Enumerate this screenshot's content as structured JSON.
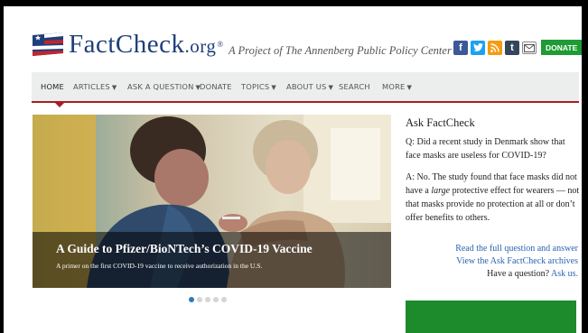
{
  "header": {
    "logo_text_main": "FactCheck",
    "logo_text_suffix": ".org",
    "logo_reg": "®",
    "tagline": "A Project of The Annenberg Public Policy Center",
    "social_icons": [
      "facebook-icon",
      "twitter-icon",
      "rss-icon",
      "tumblr-icon",
      "email-icon"
    ],
    "donate_label": "DONATE"
  },
  "nav": {
    "items": [
      {
        "label": "HOME",
        "has_dropdown": false
      },
      {
        "label": "ARTICLES",
        "has_dropdown": true
      },
      {
        "label": "ASK A QUESTION",
        "has_dropdown": true
      },
      {
        "label": "DONATE",
        "has_dropdown": false
      },
      {
        "label": "TOPICS",
        "has_dropdown": true
      },
      {
        "label": "ABOUT US",
        "has_dropdown": true
      },
      {
        "label": "SEARCH",
        "has_dropdown": false
      },
      {
        "label": "MORE",
        "has_dropdown": true
      }
    ],
    "accent_color": "#a61f24"
  },
  "hero": {
    "title": "A Guide to Pfizer/BioNTech’s COVID-19 Vaccine",
    "subtitle": "A primer on the first COVID-19 vaccine to receive authorization in the U.S.",
    "slides_total": 5,
    "active_slide": 1
  },
  "ask": {
    "title": "Ask FactCheck",
    "question": "Q: Did a recent study in Denmark show that face masks are useless for COVID-19?",
    "answer_prefix": "A: No. The study found that face masks did not have a ",
    "answer_emphasis": "large",
    "answer_suffix": " protective effect for wearers — not that masks provide no protection at all or don’t offer benefits to others.",
    "read_full_link": "Read the full question and answer",
    "archives_link": "View the Ask FactCheck archives",
    "have_question": "Have a question?",
    "ask_us_link": "Ask us."
  }
}
